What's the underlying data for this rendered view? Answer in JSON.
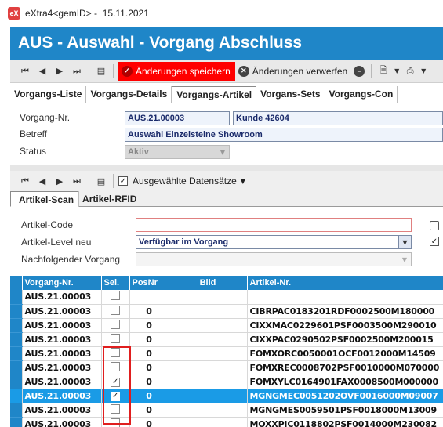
{
  "window": {
    "title": "eXtra4<gemID>",
    "date": "15.11.2021",
    "logo": "eX"
  },
  "header": {
    "title": "AUS - Auswahl - Vorgang Abschluss"
  },
  "toolbar": {
    "save_label": "Änderungen speichern",
    "discard_label": "Änderungen verwerfen"
  },
  "tabs": [
    {
      "label": "Vorgangs-Liste"
    },
    {
      "label": "Vorgangs-Details"
    },
    {
      "label": "Vorgangs-Artikel"
    },
    {
      "label": "Vorgans-Sets"
    },
    {
      "label": "Vorgangs-Con"
    }
  ],
  "form": {
    "vorgang_label": "Vorgang-Nr.",
    "vorgang_value": "AUS.21.00003",
    "kunde_value": "Kunde 42604",
    "betreff_label": "Betreff",
    "betreff_value": "Auswahl Einzelsteine Showroom",
    "status_label": "Status",
    "status_value": "Aktiv"
  },
  "subtoolbar": {
    "selected_label": "Ausgewählte Datensätze"
  },
  "subtabs": [
    {
      "label": "Artikel-Scan"
    },
    {
      "label": "Artikel-RFID"
    }
  ],
  "scan": {
    "code_label": "Artikel-Code",
    "code_value": "",
    "level_label": "Artikel-Level neu",
    "level_value": "Verfügbar im Vorgang",
    "next_label": "Nachfolgender Vorgang",
    "next_value": ""
  },
  "grid": {
    "headers": {
      "vorgang": "Vorgang-Nr.",
      "sel": "Sel.",
      "posnr": "PosNr",
      "bild": "Bild",
      "artikel": "Artikel-Nr."
    },
    "rows": [
      {
        "vorgang": "AUS.21.00003",
        "checked": false,
        "posnr": "",
        "artikel": "",
        "selected": false
      },
      {
        "vorgang": "AUS.21.00003",
        "checked": false,
        "posnr": "0",
        "artikel": "CIBRPAC0183201RDF0002500M180000",
        "selected": false
      },
      {
        "vorgang": "AUS.21.00003",
        "checked": false,
        "posnr": "0",
        "artikel": "CIXXMAC0229601PSF0003500M290010",
        "selected": false
      },
      {
        "vorgang": "AUS.21.00003",
        "checked": false,
        "posnr": "0",
        "artikel": "CIXXPAC0290502PSF0002500M200015",
        "selected": false
      },
      {
        "vorgang": "AUS.21.00003",
        "checked": false,
        "posnr": "0",
        "artikel": "FOMXORC0050001OCF0012000M14509",
        "selected": false
      },
      {
        "vorgang": "AUS.21.00003",
        "checked": false,
        "posnr": "0",
        "artikel": "FOMXREC0008702PSF0010000M070000",
        "selected": false
      },
      {
        "vorgang": "AUS.21.00003",
        "checked": true,
        "posnr": "0",
        "artikel": "FOMXYLC0164901FAX0008500M000000",
        "selected": false
      },
      {
        "vorgang": "AUS.21.00003",
        "checked": true,
        "posnr": "0",
        "artikel": "MGNGMEC0051202OVF0016000M09007",
        "selected": true
      },
      {
        "vorgang": "AUS.21.00003",
        "checked": false,
        "posnr": "0",
        "artikel": "MGNGMES0059501PSF0018000M13009",
        "selected": false
      },
      {
        "vorgang": "AUS.21.00003",
        "checked": false,
        "posnr": "0",
        "artikel": "MOXXPIC0118802PSF0014000M230082",
        "selected": false
      }
    ]
  },
  "colors": {
    "accent": "#1f86c8",
    "save": "#ff0000",
    "highlight": "#e01e1e"
  }
}
